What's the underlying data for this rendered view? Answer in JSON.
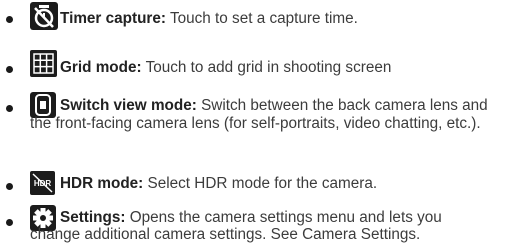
{
  "items": [
    {
      "icon": "timer-icon",
      "term": "Timer capture:",
      "desc": "Touch to set a capture time."
    },
    {
      "icon": "grid-icon",
      "term": "Grid mode:",
      "desc": "Touch to add grid in shooting screen"
    },
    {
      "icon": "switch-camera-icon",
      "term": "Switch view mode:",
      "desc_line1": "Switch between the back camera lens and",
      "desc_rest": "the front-facing camera lens (for self-portraits, video chatting, etc.)."
    },
    {
      "icon": "hdr-icon",
      "icon_text": "HDR",
      "term": "HDR mode:",
      "desc": "Select HDR mode for the camera."
    },
    {
      "icon": "settings-gear-icon",
      "term": "Settings:",
      "desc_line1": "Opens the camera settings menu and lets you",
      "desc_rest": "change additional camera settings. See Camera Settings."
    }
  ]
}
